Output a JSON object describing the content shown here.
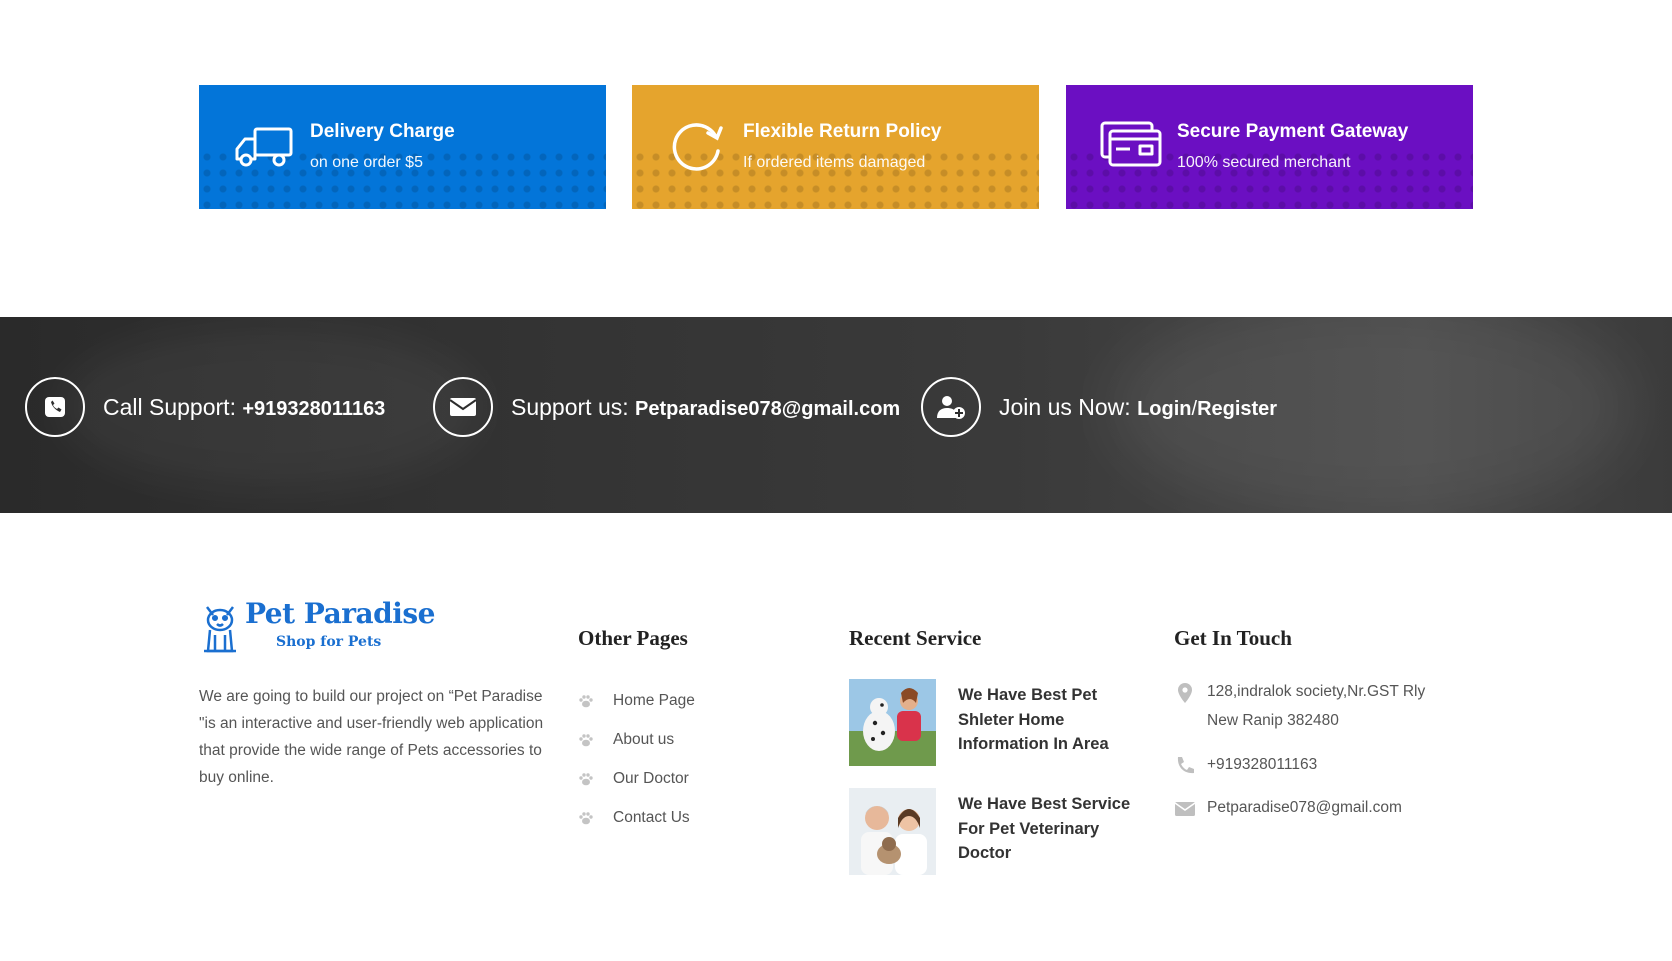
{
  "features": [
    {
      "title": "Delivery Charge",
      "subtitle": "on one order $5",
      "icon": "truck-icon",
      "color": "#0375d9"
    },
    {
      "title": "Flexible Return Policy",
      "subtitle": "If ordered items damaged",
      "icon": "refresh-icon",
      "color": "#e5a42d"
    },
    {
      "title": "Secure Payment Gateway",
      "subtitle": "100% secured merchant",
      "icon": "credit-card-icon",
      "color": "#6b0fc2"
    }
  ],
  "band": {
    "call": {
      "label": "Call Support: ",
      "value": "+919328011163",
      "icon": "phone-icon"
    },
    "support": {
      "label": "Support us: ",
      "value": "Petparadise078@gmail.com",
      "icon": "envelope-icon"
    },
    "join": {
      "label": "Join us Now: ",
      "login": "Login",
      "sep": "/",
      "register": "Register",
      "icon": "user-plus-icon"
    }
  },
  "footer": {
    "logo": {
      "title": "Pet Paradise",
      "subtitle": "Shop for Pets"
    },
    "about": "We are going to build our project on “Pet Paradise \"is an interactive and user-friendly web application that provide the wide range of Pets accessories to buy online.",
    "other_pages": {
      "title": "Other Pages",
      "links": [
        "Home Page",
        "About us",
        "Our Doctor",
        "Contact Us"
      ]
    },
    "recent_service": {
      "title": "Recent Service",
      "items": [
        {
          "title": "We Have Best Pet Shleter Home Information In Area"
        },
        {
          "title": "We Have Best Service For Pet Veterinary Doctor"
        }
      ]
    },
    "get_in_touch": {
      "title": "Get In Touch",
      "address_line1": "128,indralok society,Nr.GST Rly",
      "address_line2": "New Ranip 382480",
      "phone": "+919328011163",
      "email": "Petparadise078@gmail.com"
    }
  }
}
